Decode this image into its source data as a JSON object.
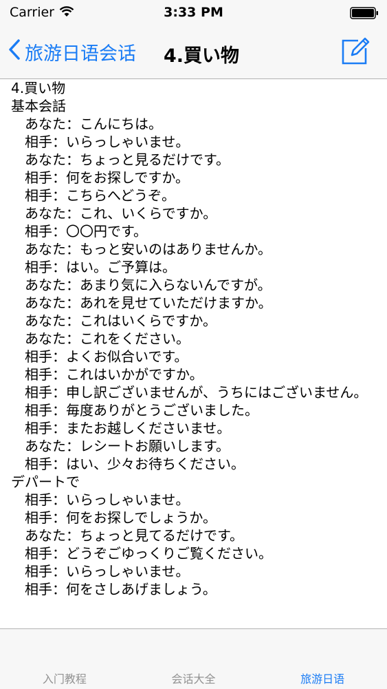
{
  "status_bar": {
    "carrier": "Carrier",
    "time": "3:33 PM"
  },
  "nav": {
    "back_label": "旅游日语会话",
    "title": "4.買い物",
    "accent_color": "#1a7cf5",
    "icons": [
      "chevron-left-icon",
      "compose-icon"
    ]
  },
  "content": {
    "lines": [
      "4.買い物",
      "基本会話",
      "　あなた：こんにちは。",
      "　相手：いらっしゃいませ。",
      "　あなた：ちょっと見るだけです。",
      "　相手：何をお探しですか。",
      "　相手：こちらへどうぞ。",
      "　あなた：これ、いくらですか。",
      "　相手：〇〇円です。",
      "　あなた：もっと安いのはありませんか。",
      "　相手：はい。ご予算は。",
      "　あなた：あまり気に入らないんですが。",
      "　あなた：あれを見せていただけますか。",
      "　あなた：これはいくらですか。",
      "　あなた：これをください。",
      "　相手：よくお似合いです。",
      "　相手：これはいかがですか。",
      "　相手：申し訳ございませんが、うちにはございません。",
      "　相手：毎度ありがとうございました。",
      "　相手：またお越しくださいませ。",
      "　あなた：レシートお願いします。",
      "　相手：はい、少々お待ちください。",
      "デパートで",
      "　相手：いらっしゃいませ。",
      "　相手：何をお探しでしょうか。",
      "　あなた：ちょっと見てるだけです。",
      "　相手：どうぞごゆっくりご覧ください。",
      "　相手：いらっしゃいませ。",
      "　相手：何をさしあげましょう。"
    ]
  },
  "tab_bar": {
    "tabs": [
      {
        "label": "入门教程",
        "active": false
      },
      {
        "label": "会话大全",
        "active": false
      },
      {
        "label": "旅游日语",
        "active": true
      }
    ]
  }
}
